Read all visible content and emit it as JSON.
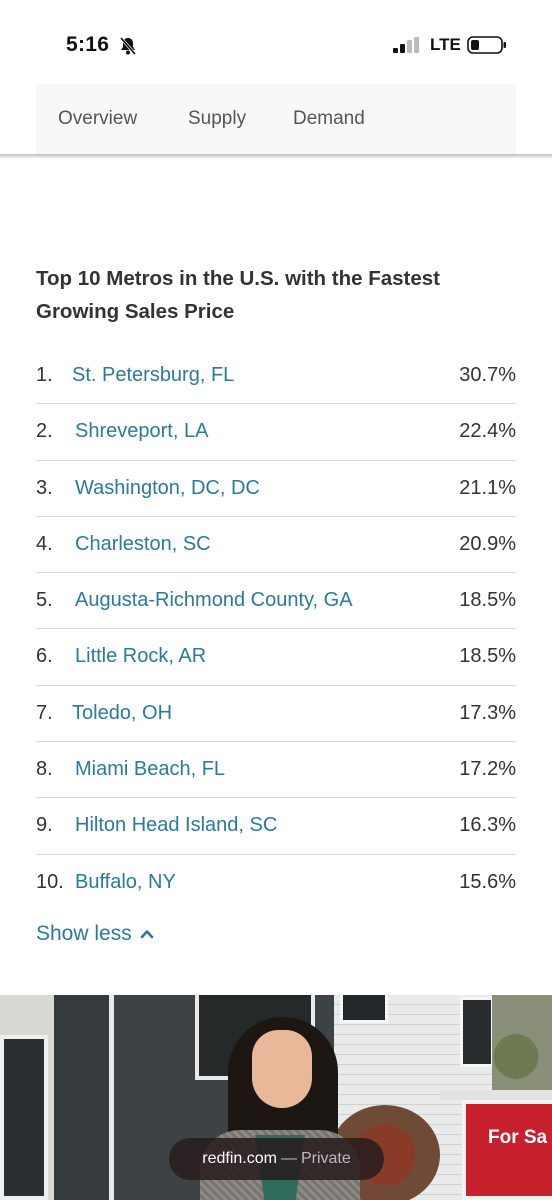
{
  "status_bar": {
    "time": "5:16",
    "network": "LTE"
  },
  "tabs": [
    {
      "label": "Overview"
    },
    {
      "label": "Supply"
    },
    {
      "label": "Demand"
    }
  ],
  "section": {
    "title": "Top 10 Metros in the U.S. with the Fastest Growing Sales Price"
  },
  "metros": [
    {
      "rank": "1.",
      "name": "St. Petersburg, FL",
      "change": "30.7%"
    },
    {
      "rank": "2.",
      "name": "Shreveport, LA",
      "change": "22.4%"
    },
    {
      "rank": "3.",
      "name": "Washington, DC, DC",
      "change": "21.1%"
    },
    {
      "rank": "4.",
      "name": "Charleston, SC",
      "change": "20.9%"
    },
    {
      "rank": "5.",
      "name": "Augusta-Richmond County, GA",
      "change": "18.5%"
    },
    {
      "rank": "6.",
      "name": "Little Rock, AR",
      "change": "18.5%"
    },
    {
      "rank": "7.",
      "name": "Toledo, OH",
      "change": "17.3%"
    },
    {
      "rank": "8.",
      "name": "Miami Beach, FL",
      "change": "17.2%"
    },
    {
      "rank": "9.",
      "name": "Hilton Head Island, SC",
      "change": "16.3%"
    },
    {
      "rank": "10.",
      "name": "Buffalo, NY",
      "change": "15.6%"
    }
  ],
  "show_less": {
    "label": "Show less",
    "icon": "chevron-up-icon"
  },
  "hero": {
    "sign_text": "For Sa"
  },
  "browser": {
    "host": "redfin.com",
    "separator": "—",
    "mode": "Private"
  },
  "colors": {
    "link": "#2b7a9a",
    "sign_red": "#c8202d"
  }
}
